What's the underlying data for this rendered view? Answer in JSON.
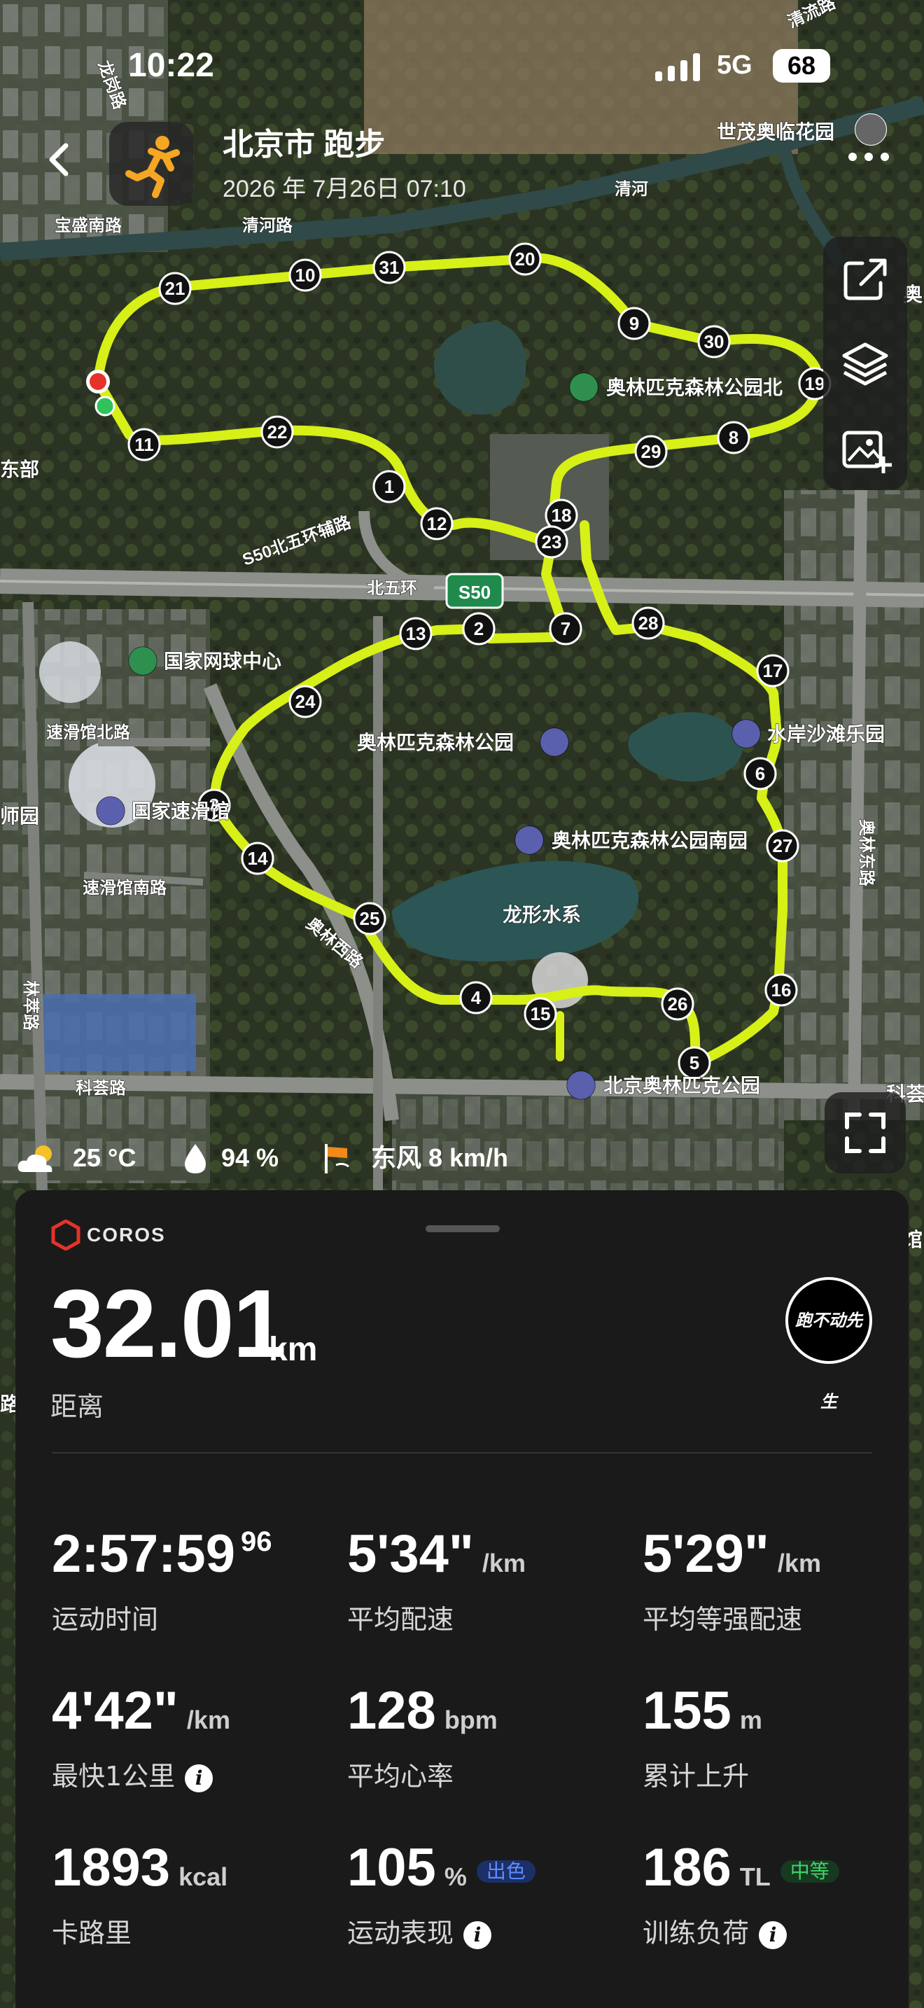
{
  "status_bar": {
    "time": "10:22",
    "network": "5G",
    "battery": "68"
  },
  "header": {
    "title": "北京市 跑步",
    "subtitle": "2026 年 7月26日 07:10"
  },
  "map": {
    "places": {
      "shimao": "世茂奥临花园",
      "forest_park_north": "奥林匹克森林公园北",
      "tennis": "国家网球中心",
      "forest_park": "奥林匹克森林公园",
      "beach": "水岸沙滩乐园",
      "speed_skating": "国家速滑馆",
      "forest_park_south": "奥林匹克森林公园南园",
      "lake": "龙形水系",
      "olympic_park": "北京奥林匹克公园",
      "partial_east": "奥",
      "partial_right2": "馆",
      "partial_left": "东部",
      "partial_left2": "师园",
      "partial_left3": "路",
      "partial_right": "科荟"
    },
    "roads": {
      "baosheng": "宝盛南路",
      "qinghe_road": "清河路",
      "qinghe": "清河",
      "longgang": "龙岗路",
      "qingliu": "清流路",
      "s50_aux": "S50北五环辅路",
      "north5": "北五环",
      "s50": "S50",
      "skating_north": "速滑馆北路",
      "skating_south": "速滑馆南路",
      "aolin_west": "奥林西路",
      "aolin_east": "奥林东路",
      "kehui": "科荟路",
      "lincui": "林萃路"
    },
    "km_markers": [
      "1",
      "2",
      "3",
      "4",
      "5",
      "6",
      "7",
      "8",
      "9",
      "10",
      "11",
      "12",
      "13",
      "14",
      "15",
      "16",
      "17",
      "18",
      "19",
      "20",
      "21",
      "22",
      "23",
      "24",
      "25",
      "26",
      "27",
      "28",
      "29",
      "30",
      "31"
    ]
  },
  "toolbar": {
    "share_icon": "share-icon",
    "layers_icon": "layers-icon",
    "add_image_icon": "add-image-icon",
    "expand_icon": "expand-icon"
  },
  "weather": {
    "temp": "25 °C",
    "humidity": "94 %",
    "wind": "东风 8 km/h"
  },
  "card": {
    "brand": "COROS",
    "distance": "32.01",
    "distance_unit": "km",
    "distance_label": "距离",
    "avatar_text": "跑不动先生",
    "metrics": [
      {
        "value": "2:57:59",
        "sup": "96",
        "unit": "",
        "label": "运动时间"
      },
      {
        "value": "5'34\"",
        "unit": "/km",
        "label": "平均配速"
      },
      {
        "value": "5'29\"",
        "unit": "/km",
        "label": "平均等强配速"
      },
      {
        "value": "4'42\"",
        "unit": "/km",
        "label": "最快1公里"
      },
      {
        "value": "128",
        "unit": "bpm",
        "label": "平均心率"
      },
      {
        "value": "155",
        "unit": "m",
        "label": "累计上升"
      },
      {
        "value": "1893",
        "unit": "kcal",
        "label": "卡路里"
      },
      {
        "value": "105",
        "unit": "%",
        "label": "运动表现",
        "tag": "出色"
      },
      {
        "value": "186",
        "unit": "TL",
        "label": "训练负荷",
        "tag": "中等"
      }
    ]
  },
  "colors": {
    "route": "#d6f018",
    "accent_red": "#e5332a",
    "tag_blue": "#2b6fff",
    "tag_green": "#2ec45a",
    "card_bg": "#1a1a1a"
  }
}
